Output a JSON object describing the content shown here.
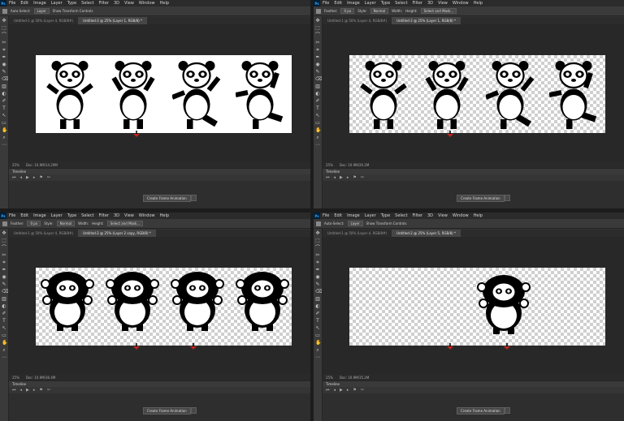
{
  "menu": [
    "File",
    "Edit",
    "Image",
    "Layer",
    "Type",
    "Select",
    "Filter",
    "3D",
    "View",
    "Window",
    "Help"
  ],
  "ps_badge": "Ps",
  "quadrants": [
    {
      "options": [
        "Auto-Select:",
        "Layer",
        "Show Transform Controls"
      ],
      "tabs": [
        "Untitled-1 @ 50% (Layer 4, RGB/8#)",
        "Untitled-2 @ 25% (Layer 1, RGB/8) *"
      ],
      "status": [
        "25%",
        "Doc: 10.9M/14.29M"
      ],
      "transparent": false
    },
    {
      "options": [
        "Feather:",
        "0 px",
        "Style:",
        "Normal",
        "Width:",
        "Height:",
        "Select and Mask..."
      ],
      "tabs": [
        "Untitled-1 @ 50% (Layer 4, RGB/8#)",
        "Untitled-2 @ 25% (Layer 1, RGB/8) *"
      ],
      "status": [
        "25%",
        "Doc: 10.9M/26.2M"
      ],
      "transparent": true
    },
    {
      "options": [
        "Feather:",
        "0 px",
        "Style:",
        "Normal",
        "Width:",
        "Height:",
        "Select and Mask..."
      ],
      "tabs": [
        "Untitled-1 @ 50% (Layer 4, RGB/8#)",
        "Untitled-2 @ 25% (Layer 2 copy, RGB/8) *"
      ],
      "status": [
        "25%",
        "Doc: 10.9M/36.4M"
      ],
      "transparent": true
    },
    {
      "options": [
        "Auto-Select:",
        "Layer",
        "Show Transform Controls"
      ],
      "tabs": [
        "Untitled-1 @ 50% (Layer 4, RGB/8#)",
        "Untitled-2 @ 25% (Layer 5, RGB/8) *"
      ],
      "status": [
        "25%",
        "Doc: 10.9M/35.2M"
      ],
      "transparent": true
    }
  ],
  "timeline": {
    "title": "Timeline",
    "create_button": "Create Frame Animation"
  }
}
